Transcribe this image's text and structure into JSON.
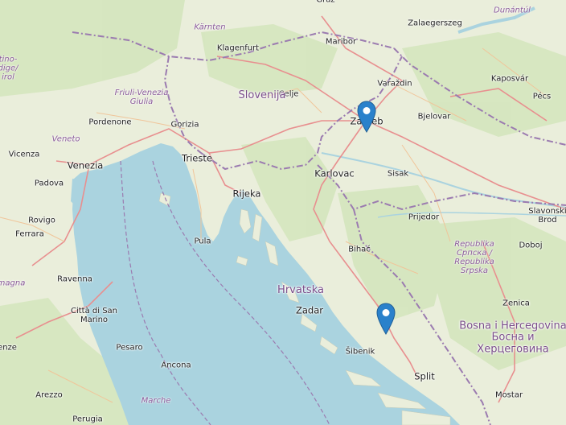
{
  "map": {
    "colors": {
      "sea": "#aad3df",
      "land": "#eaeedb",
      "forest": "#cfe3b8",
      "border": "#9b7bb0",
      "road_major": "#e88f8f",
      "road_minor": "#f2d5a8",
      "marker": "#2a81cb"
    },
    "countries": [
      {
        "id": "slovenija",
        "text": "Slovenija"
      },
      {
        "id": "hrvatska",
        "text": "Hrvatska"
      },
      {
        "id": "bih",
        "text": "Bosna i Hercegovina\nБосна и\nХерцеговина"
      }
    ],
    "regions": [
      {
        "id": "karnten",
        "text": "Kärnten"
      },
      {
        "id": "fvg",
        "text": "Friuli-Venezia\nGiulia"
      },
      {
        "id": "veneto",
        "text": "Veneto"
      },
      {
        "id": "dunantul",
        "text": "Dunántúl"
      },
      {
        "id": "srpska",
        "text": "Republika\nСрпска /\nRepublika\nSrpska"
      },
      {
        "id": "marche",
        "text": "Marche"
      },
      {
        "id": "magna",
        "text": "magna"
      },
      {
        "id": "tirol",
        "text": "tino-\ndige/\nirol"
      }
    ],
    "cities": [
      {
        "id": "graz",
        "text": "Graz"
      },
      {
        "id": "klagenfurt",
        "text": "Klagenfurt"
      },
      {
        "id": "maribor",
        "text": "Maribor"
      },
      {
        "id": "zalaegerszeg",
        "text": "Zalaegerszeg"
      },
      {
        "id": "varazdin",
        "text": "Varaždin"
      },
      {
        "id": "kaposvar",
        "text": "Kaposvár"
      },
      {
        "id": "pecs",
        "text": "Pécs"
      },
      {
        "id": "celje",
        "text": "Celje"
      },
      {
        "id": "pordenone",
        "text": "Pordenone"
      },
      {
        "id": "gorizia",
        "text": "Gorizia"
      },
      {
        "id": "bjelovar",
        "text": "Bjelovar"
      },
      {
        "id": "zagreb",
        "text": "Zagreb"
      },
      {
        "id": "vicenza",
        "text": "Vicenza"
      },
      {
        "id": "venezia",
        "text": "Venezia"
      },
      {
        "id": "trieste",
        "text": "Trieste"
      },
      {
        "id": "karlovac",
        "text": "Karlovac"
      },
      {
        "id": "sisak",
        "text": "Sisak"
      },
      {
        "id": "padova",
        "text": "Padova"
      },
      {
        "id": "rijeka",
        "text": "Rijeka"
      },
      {
        "id": "prijedor",
        "text": "Prijedor"
      },
      {
        "id": "slavonski",
        "text": "Slavonski\nBrod"
      },
      {
        "id": "rovigo",
        "text": "Rovigo"
      },
      {
        "id": "ferrara",
        "text": "Ferrara"
      },
      {
        "id": "pula",
        "text": "Pula"
      },
      {
        "id": "bihac",
        "text": "Bihać"
      },
      {
        "id": "doboj",
        "text": "Doboj"
      },
      {
        "id": "ravenna",
        "text": "Ravenna"
      },
      {
        "id": "zadar",
        "text": "Zadar"
      },
      {
        "id": "zenica",
        "text": "Zenica"
      },
      {
        "id": "sanmarino",
        "text": "Città di San\nMarino"
      },
      {
        "id": "pesaro",
        "text": "Pesaro"
      },
      {
        "id": "sibenik",
        "text": "Šibenik"
      },
      {
        "id": "firenze",
        "text": "enze"
      },
      {
        "id": "ancona",
        "text": "Ancona"
      },
      {
        "id": "split",
        "text": "Split"
      },
      {
        "id": "arezzo",
        "text": "Arezzo"
      },
      {
        "id": "mostar",
        "text": "Mostar"
      },
      {
        "id": "perugia",
        "text": "Perugia"
      }
    ],
    "markers": [
      {
        "id": "zagreb-pin",
        "label": "map-marker"
      },
      {
        "id": "dalmatia-pin",
        "label": "map-marker"
      }
    ]
  }
}
